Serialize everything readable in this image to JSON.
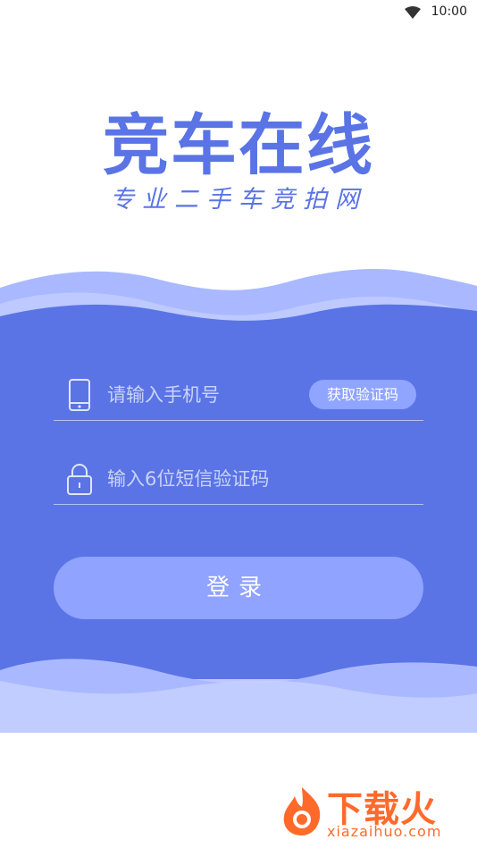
{
  "status_bar": {
    "time": "10:00"
  },
  "brand": {
    "title": "竞车在线",
    "slogan": "专业二手车竞拍网"
  },
  "login_form": {
    "phone_placeholder": "请输入手机号",
    "get_code_label": "获取验证码",
    "code_placeholder": "输入6位短信验证码",
    "login_label": "登录"
  },
  "watermark": {
    "name": "下载火",
    "domain": "xiazaihuo.com"
  },
  "colors": {
    "primary": "#5a74e6",
    "wave_light": "#aab9ff",
    "button_fill": "#8fa3ff",
    "watermark": "#ff6a2b"
  },
  "icons": {
    "wifi": "wifi-icon",
    "phone": "phone-icon",
    "lock": "lock-icon",
    "watermark_logo": "fire-logo-icon"
  }
}
